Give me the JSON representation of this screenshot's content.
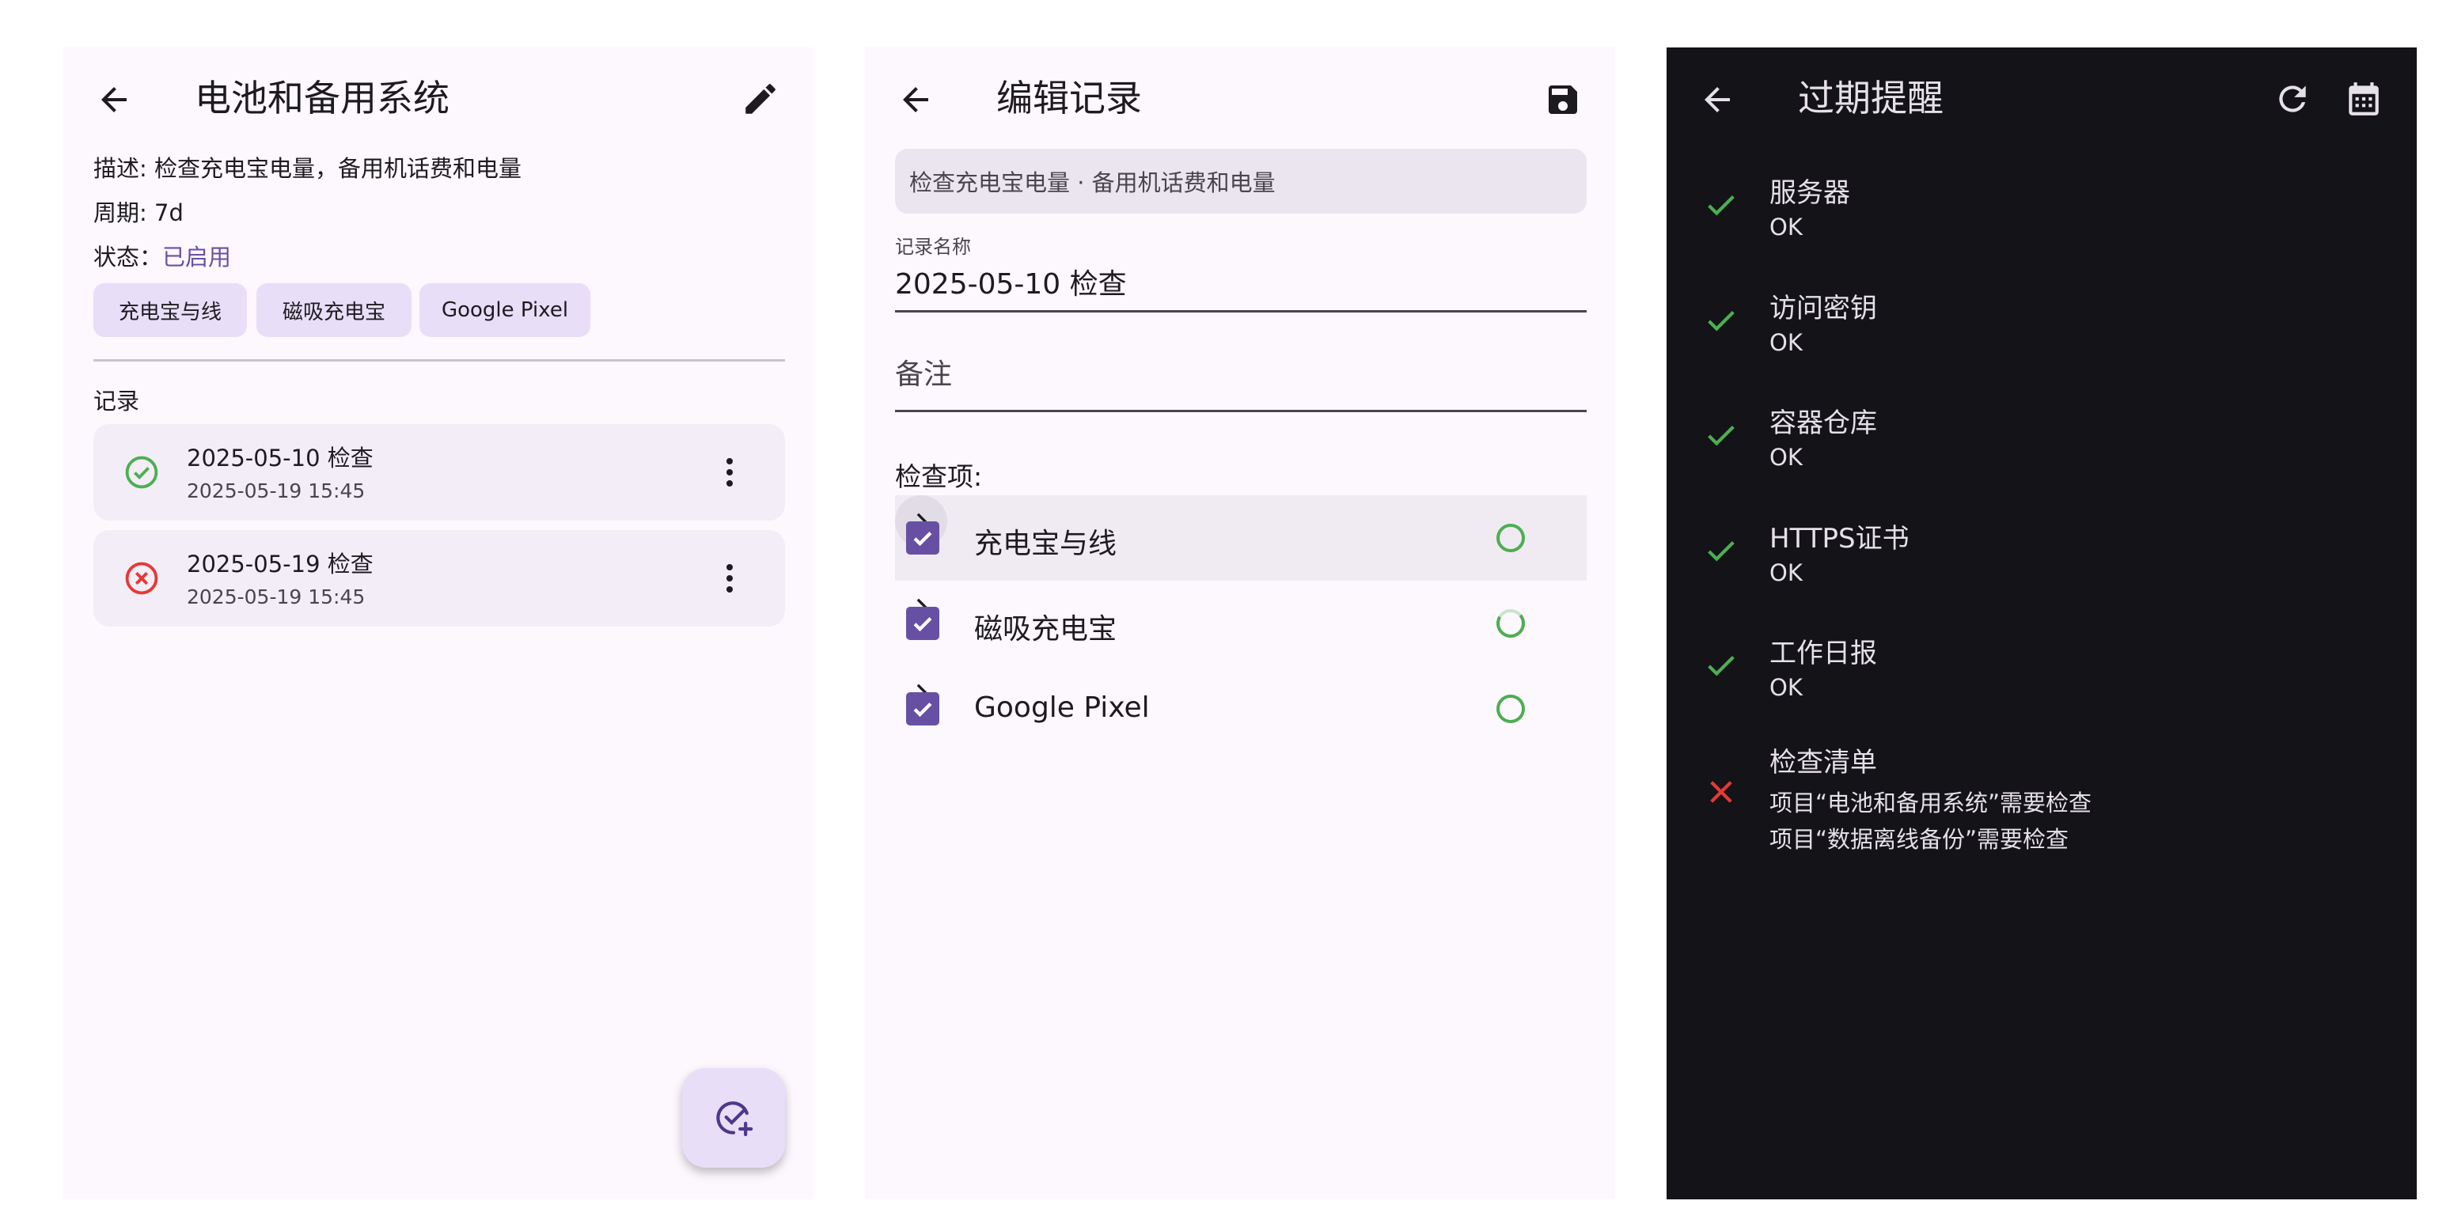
{
  "screen1": {
    "title": "电池和备用系统",
    "desc_label": "描述:",
    "desc_value": "检查充电宝电量，备用机话费和电量",
    "period_label": "周期:",
    "period_value": "7d",
    "status_label": "状态：",
    "status_value": "已启用",
    "chips": [
      "充电宝与线",
      "磁吸充电宝",
      "Google Pixel"
    ],
    "records_label": "记录",
    "records": [
      {
        "title": "2025-05-10 检查",
        "time": "2025-05-19 15:45",
        "ok": true
      },
      {
        "title": "2025-05-19 检查",
        "time": "2025-05-19 15:45",
        "ok": false
      }
    ],
    "icons": [
      "back-arrow-icon",
      "edit-pencil-icon",
      "check-circle-icon",
      "error-circle-icon",
      "more-vert-icon",
      "add-check-icon"
    ]
  },
  "screen2": {
    "title": "编辑记录",
    "description": "检查充电宝电量 · 备用机话费和电量",
    "name_label": "记录名称",
    "name_value": "2025-05-10 检查",
    "note_placeholder": "备注",
    "items_label": "检查项:",
    "items": [
      {
        "label": "充电宝与线",
        "checked": true
      },
      {
        "label": "磁吸充电宝",
        "checked": true
      },
      {
        "label": "Google Pixel",
        "checked": true
      }
    ],
    "icons": [
      "back-arrow-icon",
      "save-icon",
      "checkbox-checked-icon",
      "status-ring-icon",
      "chevron-right-icon"
    ]
  },
  "screen3": {
    "title": "过期提醒",
    "items": [
      {
        "name": "服务器",
        "status": "OK",
        "ok": true
      },
      {
        "name": "访问密钥",
        "status": "OK",
        "ok": true
      },
      {
        "name": "容器仓库",
        "status": "OK",
        "ok": true
      },
      {
        "name": "HTTPS证书",
        "status": "OK",
        "ok": true
      },
      {
        "name": "工作日报",
        "status": "OK",
        "ok": true
      },
      {
        "name": "检查清单",
        "lines": [
          "项目“电池和备用系统”需要检查",
          "项目“数据离线备份”需要检查"
        ],
        "ok": false
      }
    ],
    "icons": [
      "back-arrow-icon",
      "refresh-icon",
      "calendar-icon",
      "check-icon",
      "close-icon"
    ]
  },
  "colors": {
    "primary": "#6750a4",
    "success": "#4caf50",
    "error": "#e53935",
    "light_bg": "#fdf7fe",
    "dark_bg": "#141318"
  }
}
